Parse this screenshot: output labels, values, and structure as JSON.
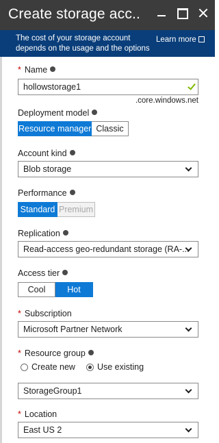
{
  "window": {
    "title": "Create storage acc..",
    "minimize_icon": "minimize-icon",
    "maximize_icon": "maximize-icon",
    "close_icon": "close-icon",
    "header_color": "#3c3c3c"
  },
  "info_bar": {
    "text": "The cost of your storage account depends on the usage and the options",
    "learn_more": "Learn more",
    "background": "#0a3e7a"
  },
  "form": {
    "name": {
      "label": "Name",
      "required": "*",
      "value": "hollowstorage1",
      "suffix": ".core.windows.net",
      "valid": true
    },
    "deployment_model": {
      "label": "Deployment model",
      "options": [
        "Resource manager",
        "Classic"
      ],
      "selected": "Resource manager"
    },
    "account_kind": {
      "label": "Account kind",
      "value": "Blob storage"
    },
    "performance": {
      "label": "Performance",
      "options": [
        "Standard",
        "Premium"
      ],
      "selected": "Standard",
      "disabled": "Premium"
    },
    "replication": {
      "label": "Replication",
      "value": "Read-access geo-redundant storage (RA-..."
    },
    "access_tier": {
      "label": "Access tier",
      "options": [
        "Cool",
        "Hot"
      ],
      "selected": "Hot"
    },
    "subscription": {
      "label": "Subscription",
      "required": "*",
      "value": "Microsoft Partner Network"
    },
    "resource_group": {
      "label": "Resource group",
      "required": "*",
      "radio_options": [
        "Create new",
        "Use existing"
      ],
      "selected": "Use existing",
      "value": "StorageGroup1"
    },
    "location": {
      "label": "Location",
      "required": "*",
      "value": "East US 2"
    }
  },
  "colors": {
    "accent": "#0e7ad6",
    "required": "#c70000",
    "valid": "#7fba00"
  }
}
